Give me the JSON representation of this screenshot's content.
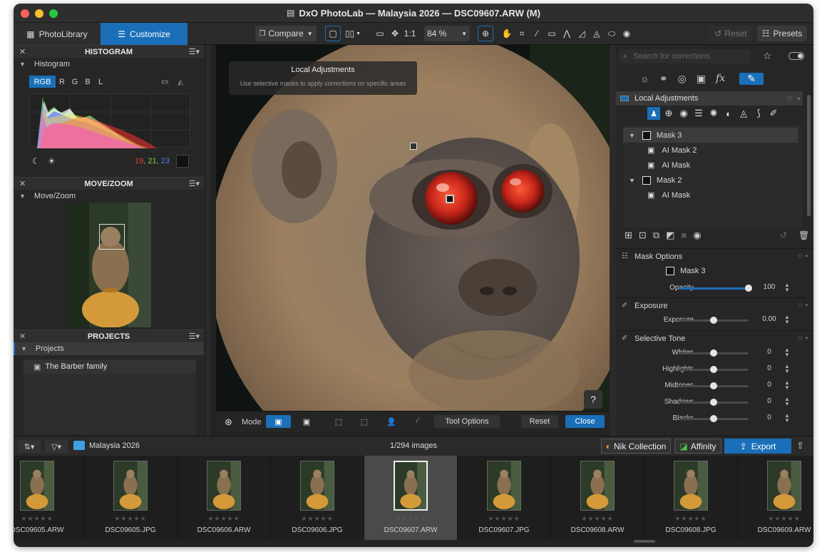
{
  "window": {
    "title": "DxO PhotoLab — Malaysia 2026 — DSC09607.ARW (M)"
  },
  "toolbar": {
    "photolibrary": "PhotoLibrary",
    "customize": "Customize",
    "compare": "Compare",
    "one_to_one": "1:1",
    "zoom": "84 %",
    "reset": "Reset",
    "presets": "Presets"
  },
  "histogram": {
    "title": "HISTOGRAM",
    "sub": "Histogram",
    "channels": [
      "RGB",
      "R",
      "G",
      "B",
      "L"
    ],
    "readout": {
      "r": "19",
      "g": "21",
      "b": "23"
    }
  },
  "movezoom": {
    "title": "MOVE/ZOOM",
    "sub": "Move/Zoom"
  },
  "projects": {
    "title": "PROJECTS",
    "sub": "Projects",
    "items": [
      "The Barber family"
    ]
  },
  "overlay": {
    "title": "Local Adjustments",
    "desc": "Use selective masks to apply corrections on specific areas"
  },
  "centerbar": {
    "mode": "Mode",
    "tool_options": "Tool Options",
    "reset": "Reset",
    "close": "Close",
    "help": "?"
  },
  "right": {
    "search_placeholder": "Search for corrections",
    "local_adjustments": "Local Adjustments",
    "masks": [
      {
        "label": "Mask 3",
        "level": 0,
        "selected": true
      },
      {
        "label": "AI Mask 2",
        "level": 1
      },
      {
        "label": "AI Mask",
        "level": 1
      },
      {
        "label": "Mask 2",
        "level": 0
      },
      {
        "label": "AI Mask",
        "level": 1
      }
    ],
    "mask_options": {
      "title": "Mask Options",
      "mask_name": "Mask 3",
      "opacity_label": "Opacity",
      "opacity_value": "100",
      "opacity_pos": 1.0
    },
    "exposure": {
      "title": "Exposure",
      "label": "Exposure",
      "value": "0.00",
      "pos": 0.5
    },
    "selective_tone": {
      "title": "Selective Tone",
      "rows": [
        {
          "label": "Whites",
          "value": "0",
          "pos": 0.5
        },
        {
          "label": "Highlights",
          "value": "0",
          "pos": 0.5
        },
        {
          "label": "Midtones",
          "value": "0",
          "pos": 0.5
        },
        {
          "label": "Shadows",
          "value": "0",
          "pos": 0.5
        },
        {
          "label": "Blacks",
          "value": "0",
          "pos": 0.5
        }
      ]
    }
  },
  "filmbar": {
    "folder": "Malaysia 2026",
    "count": "1/294 images",
    "nik": "Nik Collection",
    "affinity": "Affinity",
    "export": "Export"
  },
  "filmstrip": [
    {
      "name": "DSC09605.ARW",
      "selected": false
    },
    {
      "name": "DSC09605.JPG",
      "selected": false
    },
    {
      "name": "DSC09606.ARW",
      "selected": false
    },
    {
      "name": "DSC09606.JPG",
      "selected": false
    },
    {
      "name": "DSC09607.ARW",
      "selected": true
    },
    {
      "name": "DSC09607.JPG",
      "selected": false
    },
    {
      "name": "DSC09608.ARW",
      "selected": false
    },
    {
      "name": "DSC09608.JPG",
      "selected": false
    },
    {
      "name": "DSC09609.ARW",
      "selected": false
    }
  ],
  "colors": {
    "accent": "#1a6fb8",
    "red_readout": "#e0433a",
    "green_readout": "#7fc94a",
    "blue_readout": "#4a7fe0"
  }
}
